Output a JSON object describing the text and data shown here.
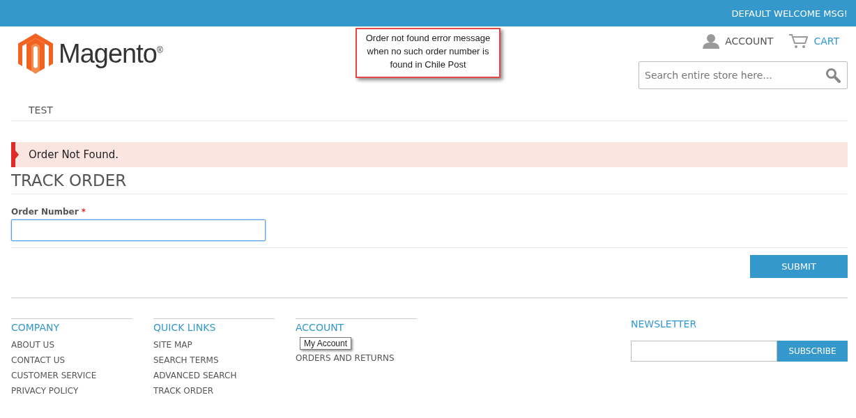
{
  "top_bar": {
    "welcome": "DEFAULT WELCOME MSG!"
  },
  "header": {
    "logo": "Magento",
    "logo_mark": "®",
    "account": "ACCOUNT",
    "cart": "CART",
    "search": {
      "placeholder": "Search entire store here..."
    }
  },
  "annotation": "Order not found error message when no such order number is found in Chile Post",
  "nav": [
    {
      "label": "TEST"
    }
  ],
  "message": {
    "text": "Order Not Found."
  },
  "page_title": "TRACK ORDER",
  "form": {
    "label": "Order Number",
    "required_mark": "*",
    "focused": true,
    "submit": "SUBMIT"
  },
  "footer": {
    "columns": [
      {
        "title": "COMPANY",
        "links": [
          "ABOUT US",
          "CONTACT US",
          "CUSTOMER SERVICE",
          "PRIVACY POLICY"
        ]
      },
      {
        "title": "QUICK LINKS",
        "links": [
          "SITE MAP",
          "SEARCH TERMS",
          "ADVANCED SEARCH",
          "TRACK ORDER"
        ]
      },
      {
        "title": "ACCOUNT",
        "links": [
          "ORDERS AND RETURNS"
        ]
      }
    ],
    "tooltip": "My Account",
    "newsletter": {
      "title": "NEWSLETTER",
      "button": "SUBSCRIBE"
    }
  }
}
